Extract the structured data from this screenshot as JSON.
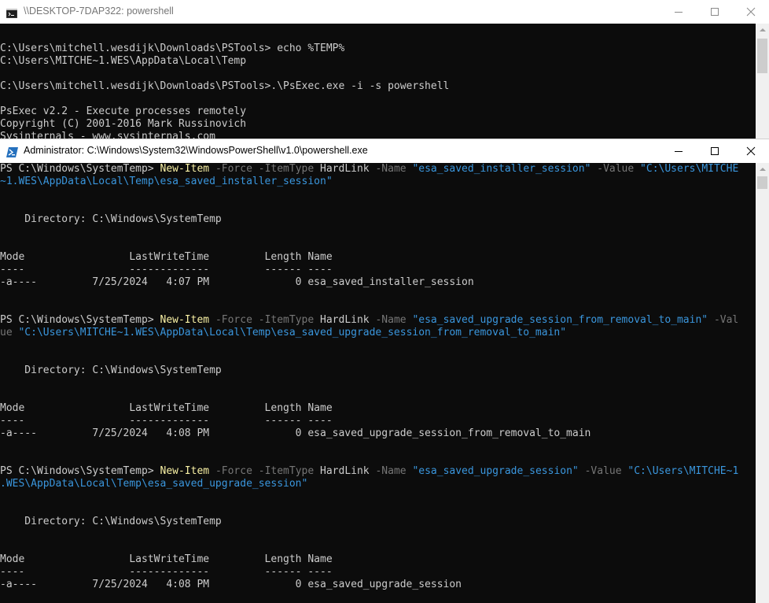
{
  "back_window": {
    "title": "\\\\DESKTOP-7DAP322: powershell",
    "lines": [
      "",
      "C:\\Users\\mitchell.wesdijk\\Downloads\\PSTools> echo %TEMP%",
      "C:\\Users\\MITCHE~1.WES\\AppData\\Local\\Temp",
      "",
      "C:\\Users\\mitchell.wesdijk\\Downloads\\PSTools>.\\PsExec.exe -i -s powershell",
      "",
      "PsExec v2.2 - Execute processes remotely",
      "Copyright (C) 2001-2016 Mark Russinovich",
      "Sysinternals - www.sysinternals.com"
    ]
  },
  "front_window": {
    "title": "Administrator: C:\\Windows\\System32\\WindowsPowerShell\\v1.0\\powershell.exe",
    "lines": [
      [
        {
          "t": "PS C:\\Windows\\SystemTemp> ",
          "c": "white"
        },
        {
          "t": "New-Item",
          "c": "yellow"
        },
        {
          "t": " -Force -ItemType ",
          "c": "gray"
        },
        {
          "t": "HardLink",
          "c": "white"
        },
        {
          "t": " -Name ",
          "c": "gray"
        },
        {
          "t": "\"esa_saved_installer_session\"",
          "c": "blue"
        },
        {
          "t": " -Value ",
          "c": "gray"
        },
        {
          "t": "\"C:\\Users\\MITCHE",
          "c": "blue"
        }
      ],
      [
        {
          "t": "~1.WES\\AppData\\Local\\Temp\\esa_saved_installer_session\"",
          "c": "blue"
        }
      ],
      [],
      [],
      [
        {
          "t": "    Directory: C:\\Windows\\SystemTemp",
          "c": "white"
        }
      ],
      [],
      [],
      [
        {
          "t": "Mode                 LastWriteTime         Length Name",
          "c": "white"
        }
      ],
      [
        {
          "t": "----                 -------------         ------ ----",
          "c": "white"
        }
      ],
      [
        {
          "t": "-a----         7/25/2024   4:07 PM              0 esa_saved_installer_session",
          "c": "white"
        }
      ],
      [],
      [],
      [
        {
          "t": "PS C:\\Windows\\SystemTemp> ",
          "c": "white"
        },
        {
          "t": "New-Item",
          "c": "yellow"
        },
        {
          "t": " -Force -ItemType ",
          "c": "gray"
        },
        {
          "t": "HardLink",
          "c": "white"
        },
        {
          "t": " -Name ",
          "c": "gray"
        },
        {
          "t": "\"esa_saved_upgrade_session_from_removal_to_main\"",
          "c": "blue"
        },
        {
          "t": " -Val",
          "c": "gray"
        }
      ],
      [
        {
          "t": "ue ",
          "c": "gray"
        },
        {
          "t": "\"C:\\Users\\MITCHE~1.WES\\AppData\\Local\\Temp\\esa_saved_upgrade_session_from_removal_to_main\"",
          "c": "blue"
        }
      ],
      [],
      [],
      [
        {
          "t": "    Directory: C:\\Windows\\SystemTemp",
          "c": "white"
        }
      ],
      [],
      [],
      [
        {
          "t": "Mode                 LastWriteTime         Length Name",
          "c": "white"
        }
      ],
      [
        {
          "t": "----                 -------------         ------ ----",
          "c": "white"
        }
      ],
      [
        {
          "t": "-a----         7/25/2024   4:08 PM              0 esa_saved_upgrade_session_from_removal_to_main",
          "c": "white"
        }
      ],
      [],
      [],
      [
        {
          "t": "PS C:\\Windows\\SystemTemp> ",
          "c": "white"
        },
        {
          "t": "New-Item",
          "c": "yellow"
        },
        {
          "t": " -Force -ItemType ",
          "c": "gray"
        },
        {
          "t": "HardLink",
          "c": "white"
        },
        {
          "t": " -Name ",
          "c": "gray"
        },
        {
          "t": "\"esa_saved_upgrade_session\"",
          "c": "blue"
        },
        {
          "t": " -Value ",
          "c": "gray"
        },
        {
          "t": "\"C:\\Users\\MITCHE~1",
          "c": "blue"
        }
      ],
      [
        {
          "t": ".WES\\AppData\\Local\\Temp\\esa_saved_upgrade_session\"",
          "c": "blue"
        }
      ],
      [],
      [],
      [
        {
          "t": "    Directory: C:\\Windows\\SystemTemp",
          "c": "white"
        }
      ],
      [],
      [],
      [
        {
          "t": "Mode                 LastWriteTime         Length Name",
          "c": "white"
        }
      ],
      [
        {
          "t": "----                 -------------         ------ ----",
          "c": "white"
        }
      ],
      [
        {
          "t": "-a----         7/25/2024   4:08 PM              0 esa_saved_upgrade_session",
          "c": "white"
        }
      ]
    ]
  },
  "colors": {
    "console_bg": "#0c0c0c",
    "text": "#cccccc",
    "command": "#f9f1a5",
    "parameter": "#767676",
    "string": "#3a96dd"
  },
  "icons": {
    "back_window": "cmd-console-icon",
    "front_window": "powershell-icon",
    "controls": [
      "minimize-icon",
      "maximize-icon",
      "close-icon"
    ]
  }
}
